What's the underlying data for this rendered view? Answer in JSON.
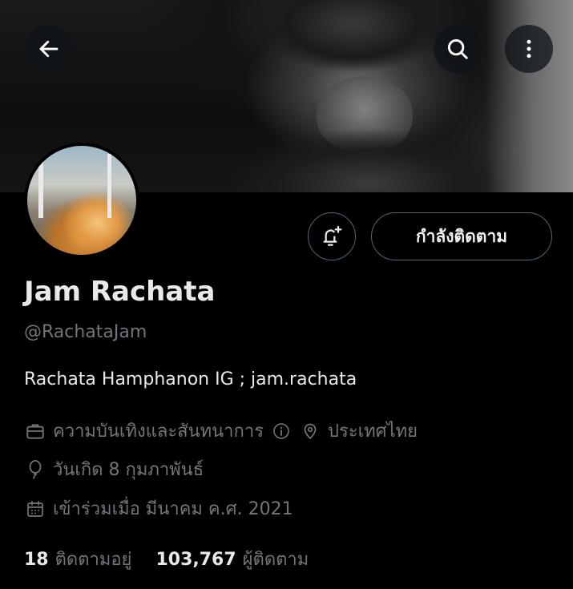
{
  "header": {
    "back_icon": "arrow-left-icon",
    "search_icon": "search-icon",
    "more_icon": "more-vertical-icon"
  },
  "profile": {
    "name": "Jam Rachata",
    "handle": "@RachataJam",
    "bio": "Rachata Hamphanon IG ; jam.rachata",
    "category": "ความบันเทิงและสันทนาการ",
    "location": "ประเทศไทย",
    "birthday": "วันเกิด 8 กุมภาพันธ์",
    "joined": "เข้าร่วมเมื่อ มีนาคม ค.ศ. 2021"
  },
  "actions": {
    "following_label": "กำลังติดตาม",
    "notify_icon": "bell-plus-icon"
  },
  "stats": {
    "following_count": "18",
    "following_label": "ติดตามอยู่",
    "followers_count": "103,767",
    "followers_label": "ผู้ติดตาม"
  },
  "colors": {
    "background": "#000000",
    "primary_text": "#e7e9ea",
    "secondary_text": "#71767b",
    "button_border": "#536471"
  }
}
